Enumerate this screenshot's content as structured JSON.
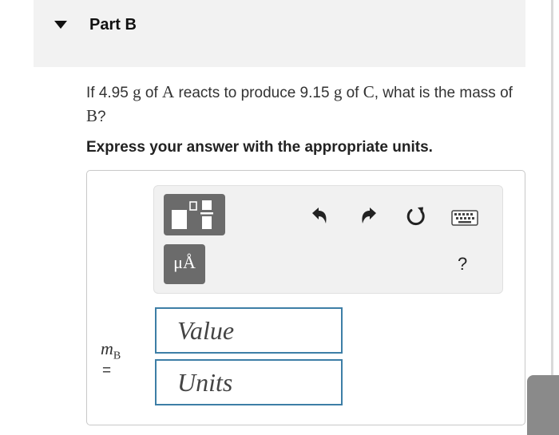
{
  "part": {
    "title": "Part B"
  },
  "question": {
    "p1": "If 4.95 ",
    "g1": "g",
    "p2": " of ",
    "a": "A",
    "p3": " reacts to produce 9.15 ",
    "g2": "g",
    "p4": " of ",
    "c": "C",
    "p5": ", what is the mass of ",
    "b": "B",
    "p6": "?"
  },
  "instruction": "Express your answer with the appropriate units.",
  "toolbar": {
    "units_label": "μÅ",
    "help_label": "?",
    "icons": [
      "templates-icon",
      "units-icon",
      "undo-icon",
      "redo-icon",
      "reset-icon",
      "keyboard-icon",
      "help-icon"
    ]
  },
  "answer": {
    "var_symbol": "m",
    "var_subscript": "B",
    "equals": "=",
    "value_placeholder": "Value",
    "units_placeholder": "Units"
  },
  "colors": {
    "field_border": "#3d7ea6",
    "tool_button": "#6b6b6b",
    "header_bg": "#f2f2f2"
  }
}
